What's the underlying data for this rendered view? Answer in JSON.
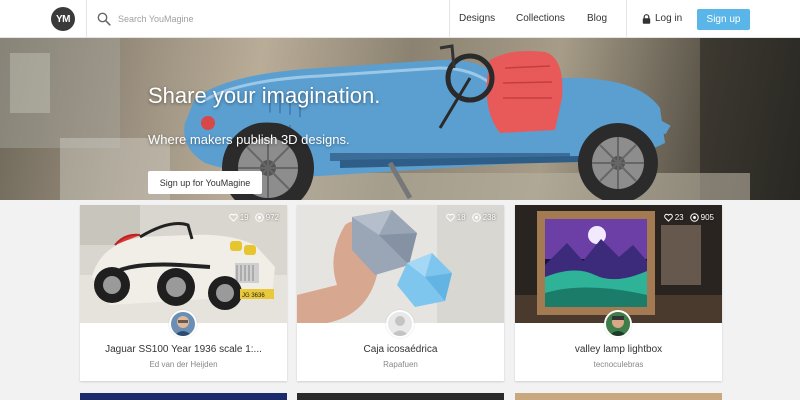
{
  "header": {
    "logo_text": "YM",
    "search_placeholder": "Search YouMagine",
    "nav": [
      "Designs",
      "Collections",
      "Blog"
    ],
    "login_label": "Log in",
    "signup_label": "Sign up",
    "accent_color": "#5ab6e8"
  },
  "hero": {
    "title": "Share your imagination.",
    "subtitle": "Where makers publish 3D designs.",
    "cta_label": "Sign up for YouMagine"
  },
  "cards": [
    {
      "title": "Jaguar SS100 Year 1936 scale 1:...",
      "author": "Ed van der Heijden",
      "likes": "19",
      "views": "972"
    },
    {
      "title": "Caja icosaédrica",
      "author": "Rapafuen",
      "likes": "18",
      "views": "238"
    },
    {
      "title": "valley lamp lightbox",
      "author": "tecnoculebras",
      "likes": "23",
      "views": "905"
    }
  ],
  "icons": {
    "search": "search-icon",
    "lock": "lock-icon",
    "heart": "heart-icon",
    "eye": "eye-icon"
  }
}
